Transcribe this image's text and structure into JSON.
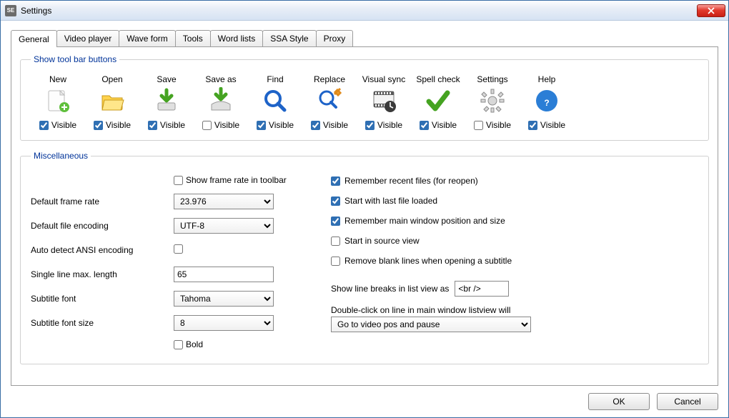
{
  "window": {
    "title": "Settings"
  },
  "tabs": {
    "general": "General",
    "video": "Video player",
    "wave": "Wave form",
    "tools": "Tools",
    "word": "Word lists",
    "ssa": "SSA Style",
    "proxy": "Proxy"
  },
  "toolbar_group_title": "Show tool bar buttons",
  "visible_label": "Visible",
  "tools_items": {
    "new": {
      "label": "New",
      "visible": true
    },
    "open": {
      "label": "Open",
      "visible": true
    },
    "save": {
      "label": "Save",
      "visible": true
    },
    "saveas": {
      "label": "Save as",
      "visible": false
    },
    "find": {
      "label": "Find",
      "visible": true
    },
    "replace": {
      "label": "Replace",
      "visible": true
    },
    "vsync": {
      "label": "Visual sync",
      "visible": true
    },
    "spell": {
      "label": "Spell check",
      "visible": true
    },
    "settings": {
      "label": "Settings",
      "visible": false
    },
    "help": {
      "label": "Help",
      "visible": true
    }
  },
  "misc_group_title": "Miscellaneous",
  "left": {
    "show_framerate_label": "Show frame rate in toolbar",
    "show_framerate": false,
    "default_framerate_label": "Default frame rate",
    "default_framerate": "23.976",
    "default_encoding_label": "Default file encoding",
    "default_encoding": "UTF-8",
    "auto_ansi_label": "Auto detect ANSI encoding",
    "auto_ansi": false,
    "single_line_max_label": "Single line max. length",
    "single_line_max": "65",
    "subtitle_font_label": "Subtitle font",
    "subtitle_font": "Tahoma",
    "subtitle_font_size_label": "Subtitle font size",
    "subtitle_font_size": "8",
    "bold_label": "Bold",
    "bold": false
  },
  "right": {
    "remember_recent_label": "Remember recent files (for reopen)",
    "remember_recent": true,
    "start_last_label": "Start with last file loaded",
    "start_last": true,
    "remember_window_label": "Remember main window position and size",
    "remember_window": true,
    "start_source_label": "Start in source view",
    "start_source": false,
    "remove_blank_label": "Remove blank lines when opening a subtitle",
    "remove_blank": false,
    "linebreak_label": "Show line breaks in list view as",
    "linebreak_value": "<br />",
    "dblclick_label": "Double-click on line in main window listview will",
    "dblclick_value": "Go to video pos and pause"
  },
  "buttons": {
    "ok": "OK",
    "cancel": "Cancel"
  }
}
